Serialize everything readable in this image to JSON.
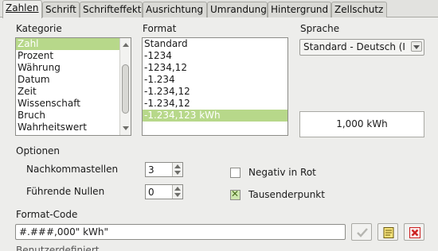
{
  "tabs": [
    {
      "label": "Zahlen",
      "active": true
    },
    {
      "label": "Schrift",
      "active": false
    },
    {
      "label": "Schrifteffekt",
      "active": false
    },
    {
      "label": "Ausrichtung",
      "active": false
    },
    {
      "label": "Umrandung",
      "active": false
    },
    {
      "label": "Hintergrund",
      "active": false
    },
    {
      "label": "Zellschutz",
      "active": false
    }
  ],
  "category": {
    "label": "Kategorie",
    "items": [
      "Zahl",
      "Prozent",
      "Währung",
      "Datum",
      "Zeit",
      "Wissenschaft",
      "Bruch",
      "Wahrheitswert"
    ],
    "selected": "Zahl"
  },
  "format": {
    "label": "Format",
    "items": [
      "Standard",
      "-1234",
      "-1234,12",
      "-1.234",
      "-1.234,12",
      "-1.234,12",
      "-1.234,123 kWh"
    ],
    "selected": "-1.234,123 kWh"
  },
  "language": {
    "label": "Sprache",
    "value": "Standard - Deutsch (I"
  },
  "preview": {
    "value": "1,000 kWh"
  },
  "options": {
    "label": "Optionen",
    "decimal_places_label": "Nachkommastellen",
    "decimal_places_value": "3",
    "leading_zeros_label": "Führende Nullen",
    "leading_zeros_value": "0",
    "negative_red_label": "Negativ in Rot",
    "negative_red_checked": false,
    "thousands_sep_label": "Tausenderpunkt",
    "thousands_sep_checked": true
  },
  "format_code": {
    "label": "Format-Code",
    "value": "#.###,000\" kWh\""
  },
  "user_defined": {
    "label": "Benutzerdefiniert"
  },
  "icons": {
    "accept": "checkmark-icon",
    "comment": "comment-icon",
    "delete": "delete-icon"
  },
  "colors": {
    "selection": "#b7d88a",
    "accent_red": "#cc2222"
  }
}
